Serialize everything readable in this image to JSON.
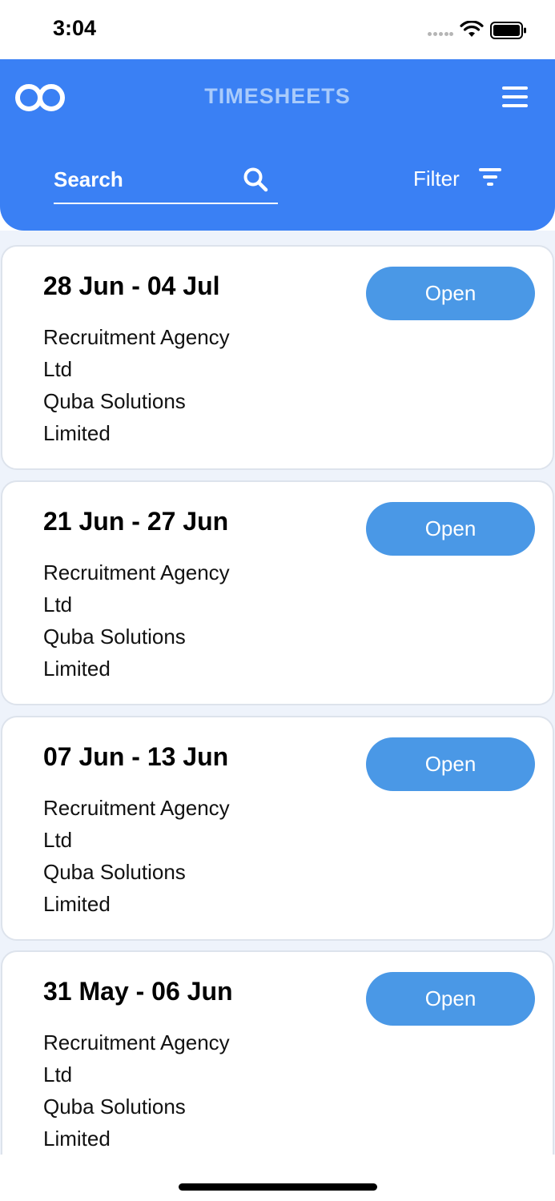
{
  "status_bar": {
    "time": "3:04"
  },
  "header": {
    "title": "TIMESHEETS",
    "search_placeholder": "Search",
    "filter_label": "Filter",
    "background_color": "#3a80f4"
  },
  "timesheets": [
    {
      "date_range": "28 Jun - 04 Jul",
      "agency": [
        "Recruitment Agency",
        "Ltd"
      ],
      "client": [
        "Quba Solutions",
        "Limited"
      ],
      "status_button": "Open"
    },
    {
      "date_range": "21 Jun - 27 Jun",
      "agency": [
        "Recruitment Agency",
        "Ltd"
      ],
      "client": [
        "Quba Solutions",
        "Limited"
      ],
      "status_button": "Open"
    },
    {
      "date_range": "07 Jun - 13 Jun",
      "agency": [
        "Recruitment Agency",
        "Ltd"
      ],
      "client": [
        "Quba Solutions",
        "Limited"
      ],
      "status_button": "Open"
    },
    {
      "date_range": "31 May - 06 Jun",
      "agency": [
        "Recruitment Agency",
        "Ltd"
      ],
      "client": [
        "Quba Solutions",
        "Limited"
      ],
      "status_button": "Open"
    }
  ],
  "icons": {
    "logo": "infinity-logo-icon",
    "menu": "hamburger-menu-icon",
    "search": "search-icon",
    "filter": "filter-icon"
  },
  "colors": {
    "header": "#3a80f4",
    "open_button": "#4a98e6",
    "list_background": "#eef3fb"
  }
}
